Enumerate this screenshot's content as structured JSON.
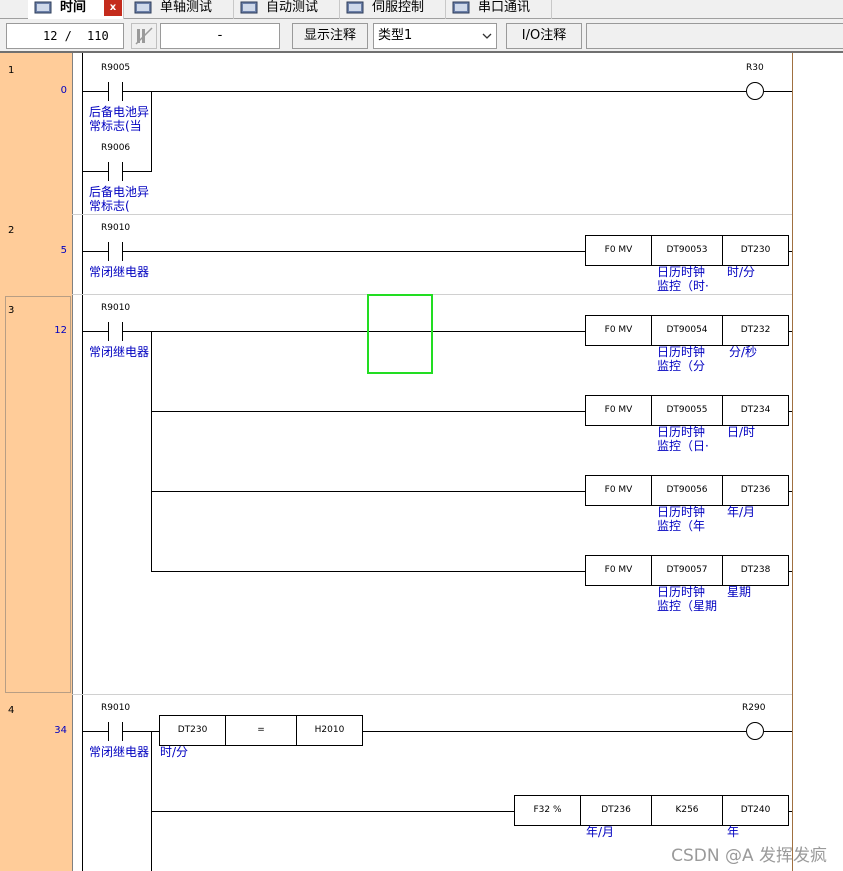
{
  "tabs": [
    {
      "label": "时间",
      "active": true
    },
    {
      "label": "单轴测试"
    },
    {
      "label": "自动测试"
    },
    {
      "label": "伺服控制"
    },
    {
      "label": "串口通讯"
    }
  ],
  "tab_close": "x",
  "toolbar": {
    "position": "12 /",
    "total": "110",
    "dash": "-",
    "show_comment": "显示注释",
    "type_select": "类型1",
    "io_comment": "I/O注释"
  },
  "rungs": [
    {
      "row": "1",
      "step": "0"
    },
    {
      "row": "2",
      "step": "5"
    },
    {
      "row": "3",
      "step": "12"
    },
    {
      "row": "4",
      "step": "34"
    }
  ],
  "r1": {
    "c1": "R9005",
    "c1_cmt1": "后备电池异",
    "c1_cmt2": "常标志(当",
    "c2": "R9006",
    "c2_cmt1": "后备电池异",
    "c2_cmt2": "常标志(",
    "coil": "R30"
  },
  "r2": {
    "c1": "R9010",
    "c1_cmt": "常闭继电器",
    "fn": "F0 MV",
    "src": "DT90053",
    "dst": "DT230",
    "src_cmt1": "日历时钟",
    "src_cmt2": "监控（时·",
    "dst_cmt": "时/分"
  },
  "r3": {
    "c1": "R9010",
    "c1_cmt": "常闭继电器",
    "b1": {
      "fn": "F0 MV",
      "src": "DT90054",
      "dst": "DT232",
      "src_cmt1": "日历时钟",
      "src_cmt2": "监控（分",
      "dst_cmt": "分/秒"
    },
    "b2": {
      "fn": "F0 MV",
      "src": "DT90055",
      "dst": "DT234",
      "src_cmt1": "日历时钟",
      "src_cmt2": "监控（日·",
      "dst_cmt": "日/时"
    },
    "b3": {
      "fn": "F0 MV",
      "src": "DT90056",
      "dst": "DT236",
      "src_cmt1": "日历时钟",
      "src_cmt2": "监控（年",
      "dst_cmt": "年/月"
    },
    "b4": {
      "fn": "F0 MV",
      "src": "DT90057",
      "dst": "DT238",
      "src_cmt1": "日历时钟",
      "src_cmt2": "监控（星期",
      "dst_cmt": "星期"
    }
  },
  "r4": {
    "c1": "R9010",
    "c1_cmt": "常闭继电器",
    "cmp_a": "DT230",
    "cmp_op": "=",
    "cmp_b": "H2010",
    "cmp_a_cmt": "时/分",
    "coil": "R290",
    "b2": {
      "fn": "F32 %",
      "a": "DT236",
      "b": "K256",
      "dst": "DT240",
      "a_cmt": "年/月",
      "dst_cmt": "年"
    }
  },
  "watermark": "CSDN @A  发挥发疯",
  "colors": {
    "left_column": "#ffcc99",
    "comment": "#0000c0",
    "selection": "#22dd22",
    "close": "#c42b1c"
  },
  "icons": [
    "window-icon",
    "close-icon",
    "pause-step-icon",
    "chevron-down-icon",
    "coil-icon"
  ]
}
